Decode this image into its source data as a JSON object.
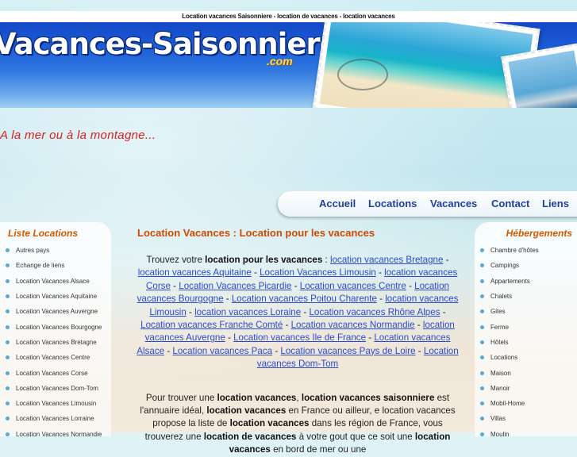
{
  "top_banner": "Location vacances Saisonniere - location de vacances - location vacances",
  "logo": {
    "main": "Vacances-Saisonnieres",
    "suffix": ".com"
  },
  "tagline": "A la mer ou à la montagne...",
  "menu": [
    "Accueil",
    "Locations",
    "Vacances",
    "Contact",
    "Liens"
  ],
  "left": {
    "title": "Liste Locations",
    "items": [
      "Autres pays",
      "Echange de liens",
      "Location Vacances Alsace",
      "Location Vacances Aquitaine",
      "Location Vacances Auvergne",
      "Location Vacances Bourgogne",
      "Location Vacances Bretagne",
      "Location Vacances Centre",
      "Location Vacances Corse",
      "Location Vacances Dom-Tom",
      "Location Vacances Limousin",
      "Location Vacances Lorraine",
      "Location Vacances Normandie"
    ]
  },
  "right": {
    "title": "Hébergements",
    "items": [
      "Chambre d'hôtes",
      "Campings",
      "Appartements",
      "Chalets",
      "Gites",
      "Ferme",
      "Hôtels",
      "Locations",
      "Maison",
      "Manoir",
      "Mobil-Home",
      "Villas",
      "Moulin"
    ]
  },
  "content": {
    "title": "Location Vacances : Location pour les vacances",
    "intro_prefix": "Trouvez votre ",
    "intro_bold": "location pour les vacances",
    "intro_colon": " : ",
    "links": [
      "location vacances Bretagne",
      "location vacances Aquitaine",
      "Location Vacances Limousin",
      "location vacances Corse",
      "Location Vacances Picardie",
      "Location vacances Centre",
      "Location vacances Bourgogne",
      "Location vacances Poitou Charente",
      "location vacances Limousin",
      "location vacances Loraine",
      "Location vacances Rhône Alpes",
      "Location vacances Franche Comté",
      "Location vacances Normandie",
      "location vacances Auvergne",
      "Location vacances Ile de France",
      "Location vacances Alsace",
      "Location vacances Paca",
      "Location vacances Pays de Loire",
      "Location vacances Dom-Tom"
    ],
    "p2": [
      {
        "t": "Pour trouver une ",
        "b": false
      },
      {
        "t": "location vacances",
        "b": true
      },
      {
        "t": ", ",
        "b": false
      },
      {
        "t": "location vacances saisonniere",
        "b": true
      },
      {
        "t": " est l'annuaire idéal, ",
        "b": false
      },
      {
        "t": "location vacances",
        "b": true
      },
      {
        "t": " en France ou ailleur, e location vacances propose la liste de ",
        "b": false
      },
      {
        "t": "location vacances",
        "b": true
      },
      {
        "t": " dans les région de France, vous trouverez une ",
        "b": false
      },
      {
        "t": "location de vacances",
        "b": true
      },
      {
        "t": " à votre gout que ce soit une ",
        "b": false
      },
      {
        "t": "location vacances",
        "b": true
      },
      {
        "t": " en bord de mer ou une",
        "b": false
      }
    ]
  }
}
